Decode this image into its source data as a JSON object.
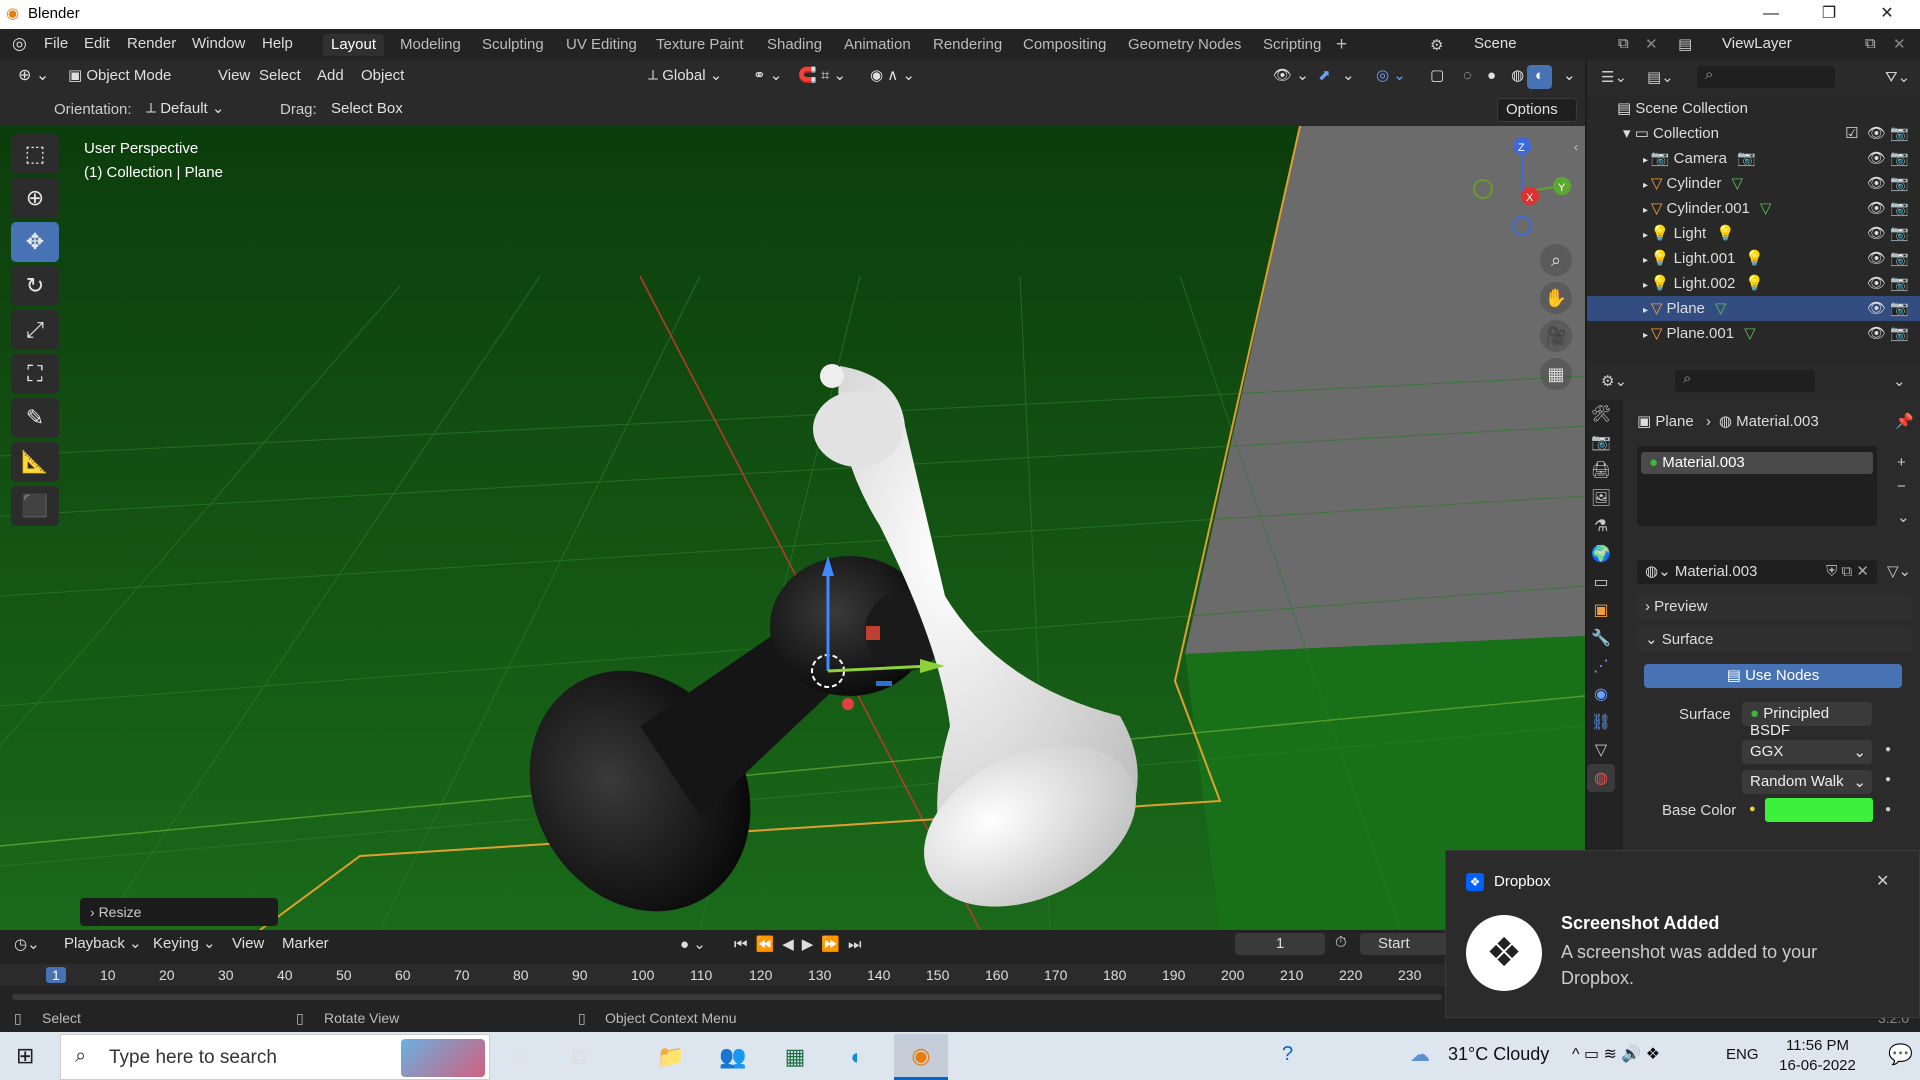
{
  "window": {
    "title": "Blender",
    "minimize": "—",
    "maximize": "❐",
    "close": "✕"
  },
  "menus": [
    "File",
    "Edit",
    "Render",
    "Window",
    "Help"
  ],
  "workspaces": [
    "Layout",
    "Modeling",
    "Sculpting",
    "UV Editing",
    "Texture Paint",
    "Shading",
    "Animation",
    "Rendering",
    "Compositing",
    "Geometry Nodes",
    "Scripting"
  ],
  "active_workspace": "Layout",
  "scene": {
    "label": "Scene",
    "viewlayer": "ViewLayer"
  },
  "viewport_header": {
    "mode": "Object Mode",
    "menus": [
      "View",
      "Select",
      "Add",
      "Object"
    ],
    "transform": "Global",
    "orientation_label": "Orientation:",
    "orientation_value": "Default",
    "drag_label": "Drag:",
    "drag_value": "Select Box",
    "options": "Options"
  },
  "viewport": {
    "perspective": "User Perspective",
    "context": "(1) Collection | Plane",
    "axes": {
      "x": "X",
      "y": "Y",
      "z": "Z"
    },
    "operator_panel": "Resize"
  },
  "outliner": {
    "root": "Scene Collection",
    "collection": "Collection",
    "items": [
      {
        "name": "Camera",
        "selected": false
      },
      {
        "name": "Cylinder",
        "selected": false
      },
      {
        "name": "Cylinder.001",
        "selected": false
      },
      {
        "name": "Light",
        "selected": false
      },
      {
        "name": "Light.001",
        "selected": false
      },
      {
        "name": "Light.002",
        "selected": false
      },
      {
        "name": "Plane",
        "selected": true
      },
      {
        "name": "Plane.001",
        "selected": false
      }
    ]
  },
  "properties": {
    "breadcrumb_object": "Plane",
    "breadcrumb_material": "Material.003",
    "slot": "Material.003",
    "material_name": "Material.003",
    "preview_label": "Preview",
    "surface_label": "Surface",
    "use_nodes": "Use Nodes",
    "surface_field_label": "Surface",
    "surface_value": "Principled BSDF",
    "distribution": "GGX",
    "subsurface": "Random Walk",
    "base_color_label": "Base Color",
    "base_color": "#3cf03c"
  },
  "timeline": {
    "menus": [
      "Playback",
      "Keying",
      "View",
      "Marker"
    ],
    "current_frame": "1",
    "start_label": "Start",
    "ticks": [
      "1",
      "10",
      "20",
      "30",
      "40",
      "50",
      "60",
      "70",
      "80",
      "90",
      "100",
      "110",
      "120",
      "130",
      "140",
      "150",
      "160",
      "170",
      "180",
      "190",
      "200",
      "210",
      "220",
      "230"
    ]
  },
  "statusbar": {
    "select": "Select",
    "rotate": "Rotate View",
    "context": "Object Context Menu",
    "version": "3.2.0"
  },
  "toast": {
    "app": "Dropbox",
    "title": "Screenshot Added",
    "body": "A screenshot was added to your Dropbox."
  },
  "taskbar": {
    "search_placeholder": "Type here to search",
    "weather": "31°C  Cloudy",
    "lang": "ENG",
    "time": "11:56 PM",
    "date": "16-06-2022"
  },
  "colors": {
    "accent": "#4772b3",
    "selected_row": "#334d80",
    "viewport_bg": "#124a12"
  }
}
